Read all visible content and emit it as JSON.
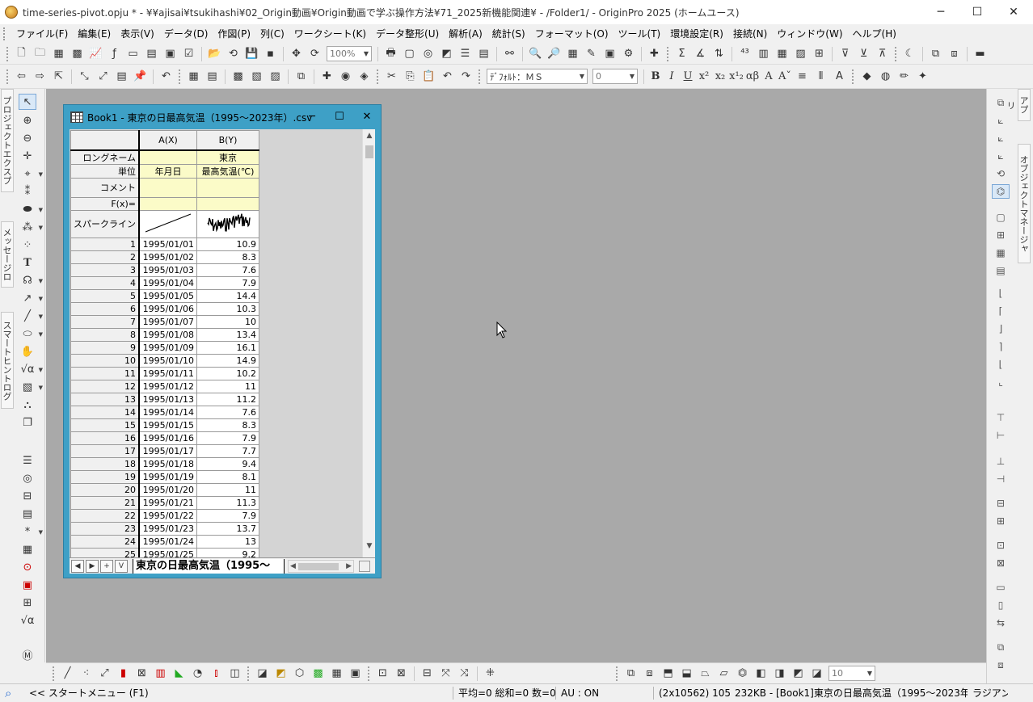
{
  "window": {
    "title": "time-series-pivot.opju * - ¥¥ajisai¥tsukihashi¥02_Origin動画¥Origin動画で学ぶ操作方法¥71_2025新機能関連¥ - /Folder1/ - OriginPro 2025 (ホームユース)",
    "minimize": "─",
    "maximize": "☐",
    "close": "✕"
  },
  "menu": [
    "ファイル(F)",
    "編集(E)",
    "表示(V)",
    "データ(D)",
    "作図(P)",
    "列(C)",
    "ワークシート(K)",
    "データ整形(U)",
    "解析(A)",
    "統計(S)",
    "フォーマット(O)",
    "ツール(T)",
    "環境設定(R)",
    "接続(N)",
    "ウィンドウ(W)",
    "ヘルプ(H)"
  ],
  "toolbar": {
    "zoom": "100%",
    "font": "ﾃﾞﾌｫﾙﾄ：ＭＳ",
    "font_size": "0",
    "bottom_size": "10"
  },
  "left_tabs": [
    "プロジェクトエクスプローラ (1)",
    "メッセージログ",
    "スマートヒントログ (2)"
  ],
  "right_tabs": [
    "アプリ",
    "オブジェクトマネージャ"
  ],
  "book": {
    "title": "Book1 - 東京の日最高気温（1995～2023年）.csv",
    "col_a_header": "A(X)",
    "col_b_header": "B(Y)",
    "meta_rows": [
      {
        "label": "ロングネーム",
        "a": "",
        "b": "東京"
      },
      {
        "label": "単位",
        "a": "年月日",
        "b": "最高気温(℃)"
      },
      {
        "label": "コメント",
        "a": "",
        "b": ""
      },
      {
        "label": "F(x)=",
        "a": "",
        "b": ""
      }
    ],
    "sparkline_label": "スパークライン",
    "rows": [
      {
        "n": "1",
        "date": "1995/01/01",
        "temp": "10.9"
      },
      {
        "n": "2",
        "date": "1995/01/02",
        "temp": "8.3"
      },
      {
        "n": "3",
        "date": "1995/01/03",
        "temp": "7.6"
      },
      {
        "n": "4",
        "date": "1995/01/04",
        "temp": "7.9"
      },
      {
        "n": "5",
        "date": "1995/01/05",
        "temp": "14.4"
      },
      {
        "n": "6",
        "date": "1995/01/06",
        "temp": "10.3"
      },
      {
        "n": "7",
        "date": "1995/01/07",
        "temp": "10"
      },
      {
        "n": "8",
        "date": "1995/01/08",
        "temp": "13.4"
      },
      {
        "n": "9",
        "date": "1995/01/09",
        "temp": "16.1"
      },
      {
        "n": "10",
        "date": "1995/01/10",
        "temp": "14.9"
      },
      {
        "n": "11",
        "date": "1995/01/11",
        "temp": "10.2"
      },
      {
        "n": "12",
        "date": "1995/01/12",
        "temp": "11"
      },
      {
        "n": "13",
        "date": "1995/01/13",
        "temp": "11.2"
      },
      {
        "n": "14",
        "date": "1995/01/14",
        "temp": "7.6"
      },
      {
        "n": "15",
        "date": "1995/01/15",
        "temp": "8.3"
      },
      {
        "n": "16",
        "date": "1995/01/16",
        "temp": "7.9"
      },
      {
        "n": "17",
        "date": "1995/01/17",
        "temp": "7.7"
      },
      {
        "n": "18",
        "date": "1995/01/18",
        "temp": "9.4"
      },
      {
        "n": "19",
        "date": "1995/01/19",
        "temp": "8.1"
      },
      {
        "n": "20",
        "date": "1995/01/20",
        "temp": "11"
      },
      {
        "n": "21",
        "date": "1995/01/21",
        "temp": "11.3"
      },
      {
        "n": "22",
        "date": "1995/01/22",
        "temp": "7.9"
      },
      {
        "n": "23",
        "date": "1995/01/23",
        "temp": "13.7"
      },
      {
        "n": "24",
        "date": "1995/01/24",
        "temp": "13"
      },
      {
        "n": "25",
        "date": "1995/01/25",
        "temp": "9.2"
      }
    ],
    "sheet_tab": "東京の日最高気温（1995～"
  },
  "status": {
    "start_menu": "<< スタートメニュー (F1)",
    "stats": "平均=0 総和=0 数=0",
    "au": "AU : ON",
    "dims": "(2x10562) 10562",
    "info": "232KB - [Book1]東京の日最高気温（1995～2023年）!",
    "angle": "ラジアン"
  },
  "colors": {
    "workspace": "#a9a9a9",
    "book_frame": "#3ea0c6",
    "meta_fill": "#fbfbc8"
  }
}
